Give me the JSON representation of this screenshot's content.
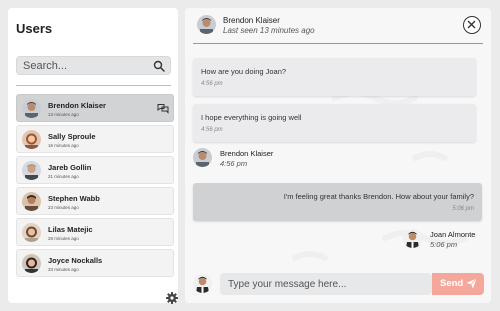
{
  "sidebar": {
    "title": "Users",
    "search_placeholder": "Search...",
    "users": [
      {
        "name": "Brendon Klaiser",
        "time": "13 minutes ago",
        "active": true,
        "icon": "chat-bubbles-icon"
      },
      {
        "name": "Sally Sproule",
        "time": "16 minutes ago",
        "active": false
      },
      {
        "name": "Jareb Gollin",
        "time": "21 minutes ago",
        "active": false
      },
      {
        "name": "Stephen Wabb",
        "time": "23 minutes ago",
        "active": false
      },
      {
        "name": "Lilas Matejic",
        "time": "28 minutes ago",
        "active": false
      },
      {
        "name": "Joyce Nockalls",
        "time": "33 minutes ago",
        "active": false
      }
    ],
    "settings_icon": "gear-icon"
  },
  "chat": {
    "header": {
      "name": "Brendon Klaiser",
      "status": "Last seen 13 minutes ago",
      "close_icon": "close-icon"
    },
    "messages": [
      {
        "text": "How are you doing Joan?",
        "time": "4:56 pm"
      },
      {
        "text": "I hope everything is going well",
        "time": "4:56 pm"
      },
      {
        "text": "I'm feeling great thanks Brendon. How about your family?",
        "time": "5:06 pm"
      }
    ],
    "incoming_sender": {
      "name": "Brendon Klaiser",
      "time": "4:56 pm"
    },
    "outgoing_sender": {
      "name": "Joan Almonte",
      "time": "5:06 pm"
    },
    "composer": {
      "placeholder": "Type your message here...",
      "send_label": "Send",
      "send_icon": "paper-plane-icon"
    }
  },
  "colors": {
    "send_button": "#f3a89b",
    "active_user": "#d2d3d5",
    "background": "#ebebeb"
  }
}
